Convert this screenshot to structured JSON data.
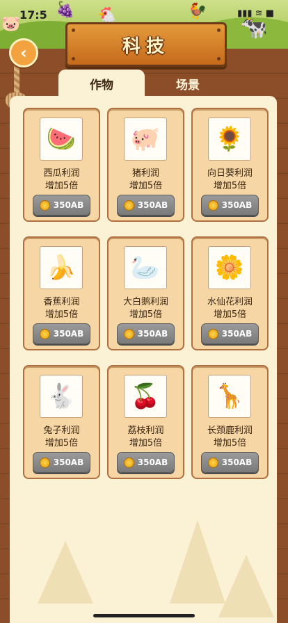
{
  "status": {
    "time": "17:5",
    "signal": "▮▮▮ ≋ ■"
  },
  "title": "科技",
  "back_icon": "chevron-left-icon",
  "tabs": [
    {
      "label": "作物",
      "active": true
    },
    {
      "label": "场景",
      "active": false
    }
  ],
  "cards": [
    {
      "name": "西瓜利润",
      "desc": "增加5倍",
      "price": "350AB",
      "icon": "watermelon-icon"
    },
    {
      "name": "猪利润",
      "desc": "增加5倍",
      "price": "350AB",
      "icon": "pig-icon"
    },
    {
      "name": "向日葵利润",
      "desc": "增加5倍",
      "price": "350AB",
      "icon": "sunflower-icon"
    },
    {
      "name": "香蕉利润",
      "desc": "增加5倍",
      "price": "350AB",
      "icon": "banana-icon"
    },
    {
      "name": "大白鹅利润",
      "desc": "增加5倍",
      "price": "350AB",
      "icon": "goose-icon"
    },
    {
      "name": "水仙花利润",
      "desc": "增加5倍",
      "price": "350AB",
      "icon": "narcissus-icon"
    },
    {
      "name": "兔子利润",
      "desc": "增加5倍",
      "price": "350AB",
      "icon": "rabbit-icon"
    },
    {
      "name": "荔枝利润",
      "desc": "增加5倍",
      "price": "350AB",
      "icon": "lychee-icon"
    },
    {
      "name": "长颈鹿利润",
      "desc": "增加5倍",
      "price": "350AB",
      "icon": "giraffe-icon"
    }
  ],
  "colors": {
    "wood": "#8b4e28",
    "panel": "#fbf1d4",
    "card": "#f5d6a4",
    "button": "#8a8a8a",
    "title": "#e59a3b"
  }
}
